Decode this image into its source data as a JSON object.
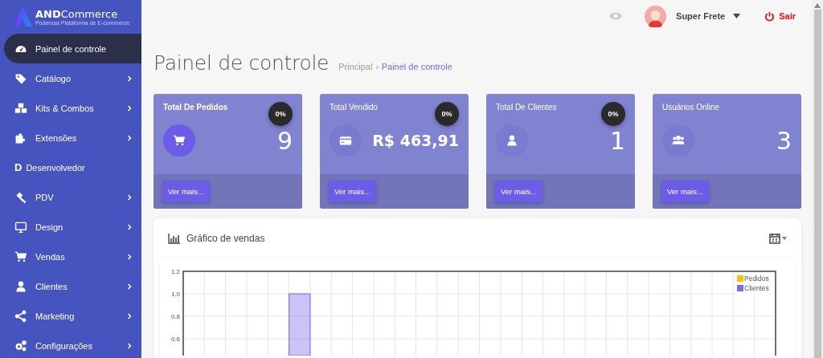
{
  "sidebar": {
    "logo": {
      "name": "**AND**Commerce",
      "tagline": "Poderosa Plataforma de E-commerce"
    },
    "items": [
      {
        "label": "Painel de controle",
        "kind": "icon",
        "selected": true,
        "submenu": false
      },
      {
        "label": "Catálogo",
        "kind": "icon",
        "selected": false,
        "submenu": true
      },
      {
        "label": "Kits & Combos",
        "kind": "icon",
        "selected": false,
        "submenu": true
      },
      {
        "label": "Extensões",
        "kind": "icon",
        "selected": false,
        "submenu": true
      },
      {
        "label": "Desenvolvedor",
        "kind": "letter",
        "letter": "D",
        "selected": false,
        "submenu": false
      },
      {
        "label": "PDV",
        "kind": "icon",
        "selected": false,
        "submenu": true
      },
      {
        "label": "Design",
        "kind": "icon",
        "selected": false,
        "submenu": true
      },
      {
        "label": "Vendas",
        "kind": "icon",
        "selected": false,
        "submenu": true
      },
      {
        "label": "Clientes",
        "kind": "icon",
        "selected": false,
        "submenu": true
      },
      {
        "label": "Marketing",
        "kind": "icon",
        "selected": false,
        "submenu": true
      },
      {
        "label": "Configurações",
        "kind": "icon",
        "selected": false,
        "submenu": true
      }
    ]
  },
  "header": {
    "user": "Super Frete",
    "logout": "Sair"
  },
  "page": {
    "title": "Painel de controle",
    "breadcrumb_separator": "›",
    "breadcrumb": [
      {
        "label": "Principal",
        "selected": false
      },
      {
        "label": "Painel de controle",
        "selected": true
      }
    ]
  },
  "cards": [
    {
      "title": "Total De Pedidos",
      "value": "9",
      "badge": "0%",
      "highlighted": true,
      "link": "Ver mais..."
    },
    {
      "title": "Total Vendido",
      "value": "R$ 463,91",
      "badge": "0%",
      "highlighted": false,
      "link": "Ver mais..."
    },
    {
      "title": "Total De Clientes",
      "value": "1",
      "badge": "0%",
      "highlighted": false,
      "link": "Ver mais..."
    },
    {
      "title": "Usuários Online",
      "value": "3",
      "highlighted": false,
      "link": "Ver mais..."
    }
  ],
  "sales_chart": {
    "title": "Gráfico de vendas",
    "chart_data": {
      "type": "bar",
      "grid": true,
      "ylim": [
        0.45,
        1.2
      ],
      "yticks": [
        {
          "value": 0.6,
          "label": "0.6"
        },
        {
          "value": 0.8,
          "label": "0.8"
        },
        {
          "value": 1.0,
          "label": "1.0"
        },
        {
          "value": 1.2,
          "label": "1.2"
        }
      ],
      "series": [
        {
          "name": "Pedidos",
          "color": "#ffc107",
          "values": [
            null,
            null,
            null,
            null,
            null,
            null,
            null,
            null,
            null,
            null,
            null,
            null,
            null,
            null,
            null,
            null,
            null,
            null,
            null,
            null,
            null,
            null,
            null,
            null,
            null,
            null,
            null,
            null
          ]
        },
        {
          "name": "Clientes",
          "color": "#7b68ee",
          "values": [
            null,
            null,
            null,
            null,
            null,
            1.0,
            null,
            null,
            null,
            null,
            null,
            null,
            null,
            null,
            null,
            null,
            null,
            null,
            null,
            null,
            null,
            null,
            null,
            null,
            null,
            null,
            null,
            null
          ]
        }
      ]
    }
  }
}
